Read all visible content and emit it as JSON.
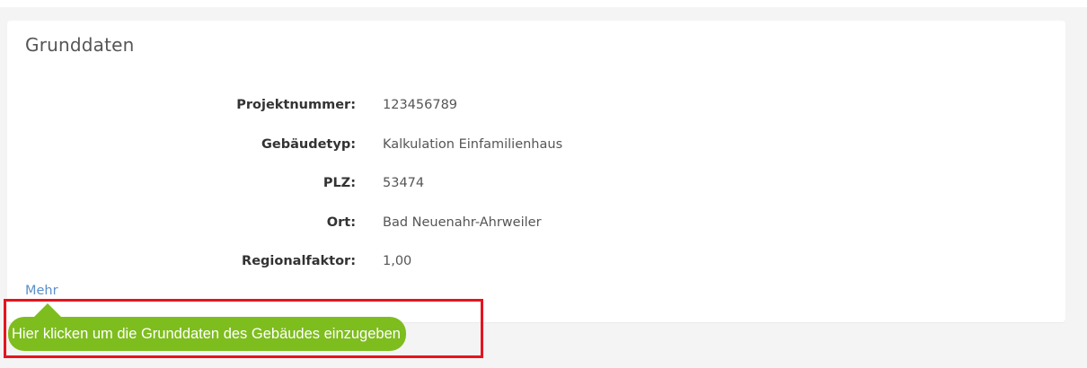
{
  "card": {
    "title": "Grunddaten"
  },
  "fields": [
    {
      "label": "Projektnummer:",
      "value": "123456789"
    },
    {
      "label": "Gebäudetyp:",
      "value": "Kalkulation Einfamilienhaus"
    },
    {
      "label": "PLZ:",
      "value": "53474"
    },
    {
      "label": "Ort:",
      "value": "Bad Neuenahr-Ahrweiler"
    },
    {
      "label": "Regionalfaktor:",
      "value": "1,00"
    }
  ],
  "more_link": "Mehr",
  "tooltip": {
    "text": "Hier klicken um die Grunddaten des Gebäudes einzugeben"
  },
  "colors": {
    "link": "#5b8fc9",
    "tooltip_bg": "#7ebd1e",
    "highlight_frame": "#e5141f"
  }
}
